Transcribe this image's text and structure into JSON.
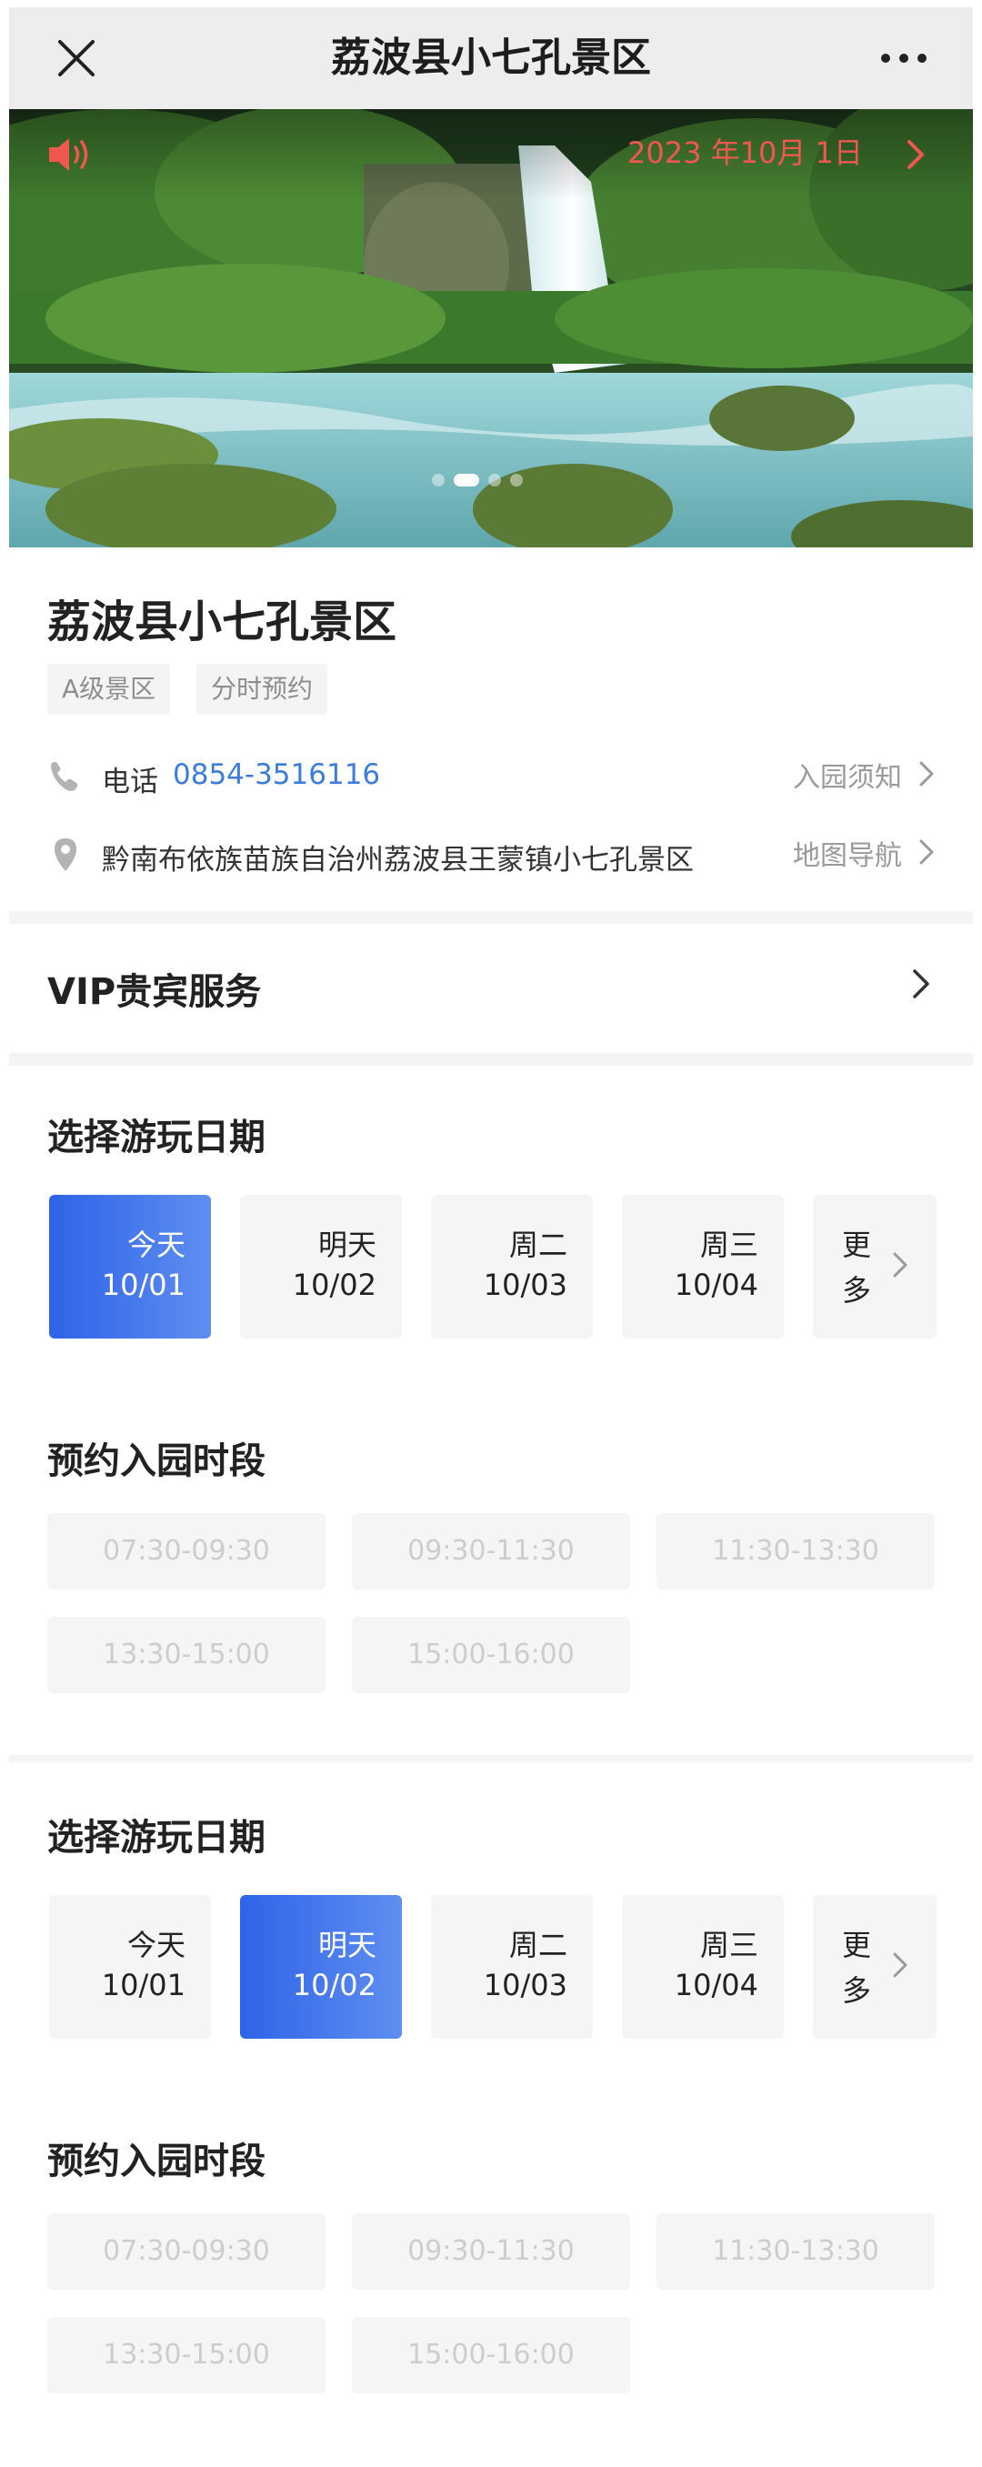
{
  "nav": {
    "title": "荔波县小七孔景区"
  },
  "banner": {
    "date": "2023 年10月 1日"
  },
  "info": {
    "name": "荔波县小七孔景区",
    "tags": [
      "A级景区",
      "分时预约"
    ],
    "phone_label": "电话",
    "phone_number": "0854-3516116",
    "notice_link": "入园须知",
    "address": "黔南布依族苗族自治州荔波县王蒙镇小七孔景区",
    "map_link": "地图导航"
  },
  "vip": {
    "label": "VIP贵宾服务"
  },
  "booking": [
    {
      "date_heading": "选择游玩日期",
      "dates": [
        {
          "weekday": "今天",
          "date": "10/01",
          "selected": true
        },
        {
          "weekday": "明天",
          "date": "10/02",
          "selected": false
        },
        {
          "weekday": "周二",
          "date": "10/03",
          "selected": false
        },
        {
          "weekday": "周三",
          "date": "10/04",
          "selected": false
        }
      ],
      "more": [
        "更",
        "多"
      ],
      "slot_heading": "预约入园时段",
      "slots": [
        "07:30-09:30",
        "09:30-11:30",
        "11:30-13:30",
        "13:30-15:00",
        "15:00-16:00"
      ]
    },
    {
      "date_heading": "选择游玩日期",
      "dates": [
        {
          "weekday": "今天",
          "date": "10/01",
          "selected": false
        },
        {
          "weekday": "明天",
          "date": "10/02",
          "selected": true
        },
        {
          "weekday": "周二",
          "date": "10/03",
          "selected": false
        },
        {
          "weekday": "周三",
          "date": "10/04",
          "selected": false
        }
      ],
      "more": [
        "更",
        "多"
      ],
      "slot_heading": "预约入园时段",
      "slots": [
        "07:30-09:30",
        "09:30-11:30",
        "11:30-13:30",
        "13:30-15:00",
        "15:00-16:00"
      ]
    }
  ],
  "colors": {
    "accent": "#2d63e8",
    "link": "#3b7ddd",
    "date_red": "#f0584f"
  },
  "icons": [
    "close-icon",
    "more-icon",
    "speaker-icon",
    "chevron-right-icon",
    "phone-icon",
    "location-pin-icon"
  ]
}
